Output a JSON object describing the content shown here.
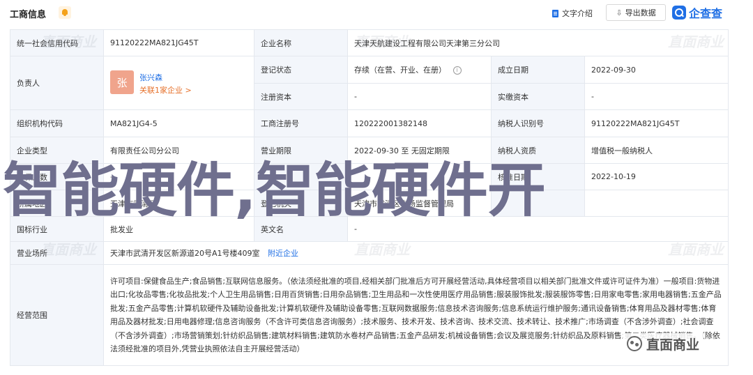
{
  "header": {
    "title": "工商信息",
    "intro_label": "文字介绍",
    "export_label": "导出数据",
    "logo_text": "企查查"
  },
  "rows": {
    "credit_code_label": "统一社会信用代码",
    "credit_code_value": "91120222MA821JG45T",
    "company_name_label": "企业名称",
    "company_name_value": "天津天航建设工程有限公司天津第三分公司",
    "legal_rep_label": "负责人",
    "person_name": "张兴森",
    "person_avatar": "张",
    "person_relation": "关联1家企业 >",
    "reg_status_label": "登记状态",
    "reg_status_value": "存续（在营、开业、在册）",
    "established_label": "成立日期",
    "established_value": "2022-09-30",
    "reg_capital_label": "注册资本",
    "reg_capital_value": "-",
    "paid_capital_label": "实缴资本",
    "paid_capital_value": "-",
    "org_code_label": "组织机构代码",
    "org_code_value": "MA821JG4-5",
    "biz_reg_no_label": "工商注册号",
    "biz_reg_no_value": "120222001382148",
    "taxpayer_id_label": "纳税人识别号",
    "taxpayer_id_value": "91120222MA821JG45T",
    "company_type_label": "企业类型",
    "company_type_value": "有限责任公司分公司",
    "biz_term_label": "营业期限",
    "biz_term_value": "2022-09-30 至 无固定期限",
    "taxpayer_qual_label": "纳税人资质",
    "taxpayer_qual_value": "增值税一般纳税人",
    "region_label": "所属地区",
    "region_value": "天津市武清区",
    "reg_authority_label": "登记机关",
    "reg_authority_value": "天津市武清区市场监督管理局",
    "approval_label": "核准日期",
    "approval_value": "2022-10-19",
    "insured_label": "参保人数",
    "insured_value": "-",
    "industry_label": "国标行业",
    "industry_value": "批发业",
    "english_name_label": "英文名",
    "english_name_value": "-",
    "address_label": "营业场所",
    "address_value": "天津市武清开发区新源道20号A1号楼409室",
    "nearby_label": "附近企业",
    "scope_label": "经营范围",
    "scope_value": "许可项目:保健食品生产;食品销售;互联网信息服务。（依法须经批准的项目,经相关部门批准后方可开展经营活动,具体经营项目以相关部门批准文件或许可证件为准）一般项目:货物进出口;化妆品零售;化妆品批发;个人卫生用品销售;日用百货销售;日用杂品销售;卫生用品和一次性使用医疗用品销售;服装服饰批发;服装服饰零售;日用家电零售;家用电器销售;五金产品批发;五金产品零售;计算机软硬件及辅助设备批发;计算机软硬件及辅助设备零售;互联网数据服务;信息技术咨询服务;信息系统运行维护服务;通讯设备销售;体育用品及器材零售;体育用品及器材批发;日用电器修理;信息咨询服务（不含许可类信息咨询服务）;技术服务、技术开发、技术咨询、技术交流、技术转让、技术推广;市场调查（不含涉外调查）;社会调查（不含涉外调查）;市场营销策划;针纺织品销售;建筑材料销售;建筑防水卷材产品销售;五金产品研发;机械设备销售;会议及展览服务;针纺织品及原料销售;第二类医疗器械销售。（除依法须经批准的项目外,凭营业执照依法自主开展经营活动）"
  },
  "watermark_text": "直面商业",
  "overlay_text": "智能硬件,智能硬件开",
  "wechat_badge_text": "直面商业",
  "colors": {
    "accent": "#1f6fe5",
    "label_bg": "#f3f6fb",
    "relation": "#e6702a",
    "avatar": "#f0a48c"
  }
}
